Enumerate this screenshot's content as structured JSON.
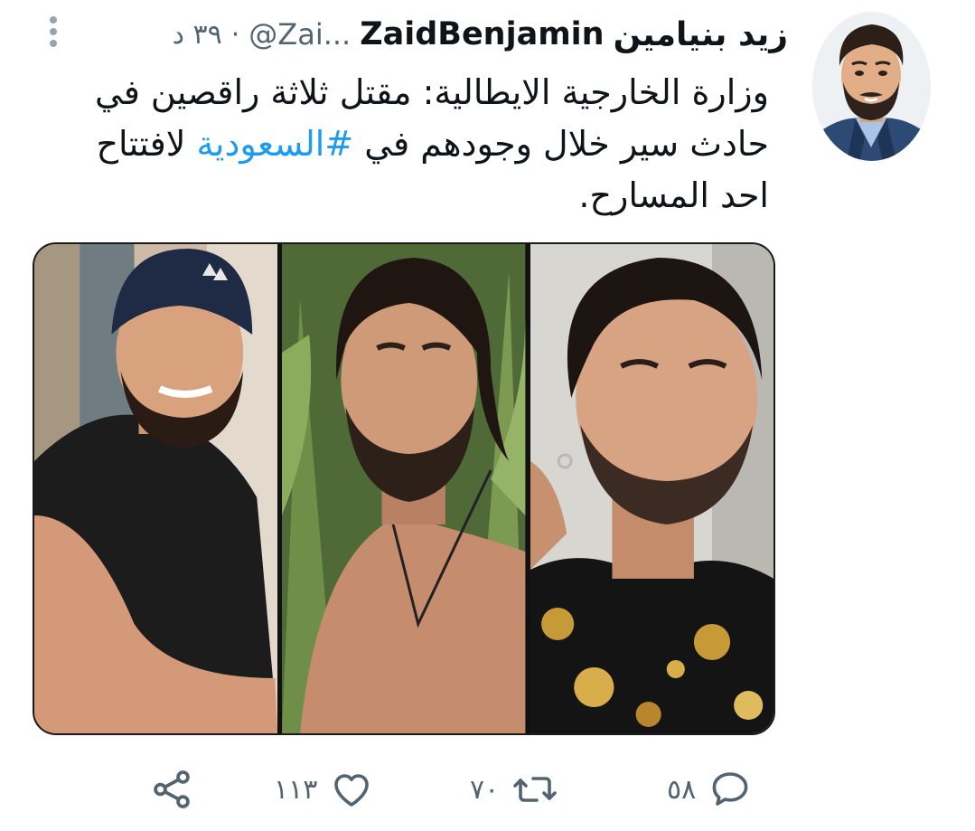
{
  "tweet": {
    "display_name_ar": "زيد بنيامين",
    "display_name_en": "ZaidBenjamin",
    "handle": "@Zai...",
    "separator": "·",
    "time": "٣٩ د",
    "text_before": "وزارة الخارجية الايطالية: مقتل ثلاثة راقصين في حادث سير خلال وجودهم في ",
    "hashtag": "#السعودية",
    "text_after": " لافتتاح احد المسارح."
  },
  "media": {
    "photo_count": 3
  },
  "actions": {
    "reply_count": "٥٨",
    "retweet_count": "٧٠",
    "like_count": "١١٣"
  },
  "colors": {
    "text": "#0f1419",
    "secondary": "#536471",
    "hashtag": "#1d9bf0"
  },
  "icons": {
    "reply": "speech-bubble-icon",
    "retweet": "retweet-arrows-icon",
    "like": "heart-icon",
    "share": "share-nodes-icon",
    "more": "vertical-dots-icon"
  }
}
